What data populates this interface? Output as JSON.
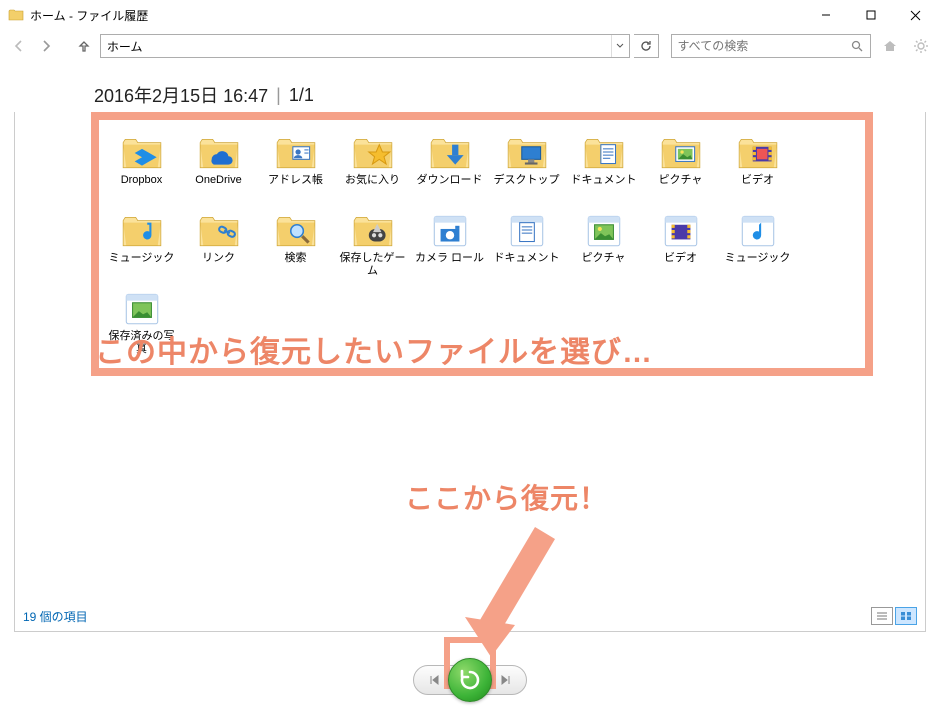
{
  "window": {
    "title": "ホーム - ファイル履歴",
    "minimize": "—",
    "maximize": "▢",
    "close": "✕"
  },
  "nav": {
    "address": "ホーム",
    "search_placeholder": "すべての検索"
  },
  "header": {
    "datetime": "2016年2月15日 16:47",
    "separator": "|",
    "page": "1/1"
  },
  "folders": [
    {
      "name": "Dropbox",
      "type": "dropbox"
    },
    {
      "name": "OneDrive",
      "type": "onedrive"
    },
    {
      "name": "アドレス帳",
      "type": "contacts"
    },
    {
      "name": "お気に入り",
      "type": "favorites"
    },
    {
      "name": "ダウンロード",
      "type": "downloads"
    },
    {
      "name": "デスクトップ",
      "type": "desktop"
    },
    {
      "name": "ドキュメント",
      "type": "documents"
    },
    {
      "name": "ピクチャ",
      "type": "pictures"
    },
    {
      "name": "ビデオ",
      "type": "videos"
    },
    {
      "name": "ミュージック",
      "type": "music"
    },
    {
      "name": "リンク",
      "type": "links"
    },
    {
      "name": "検索",
      "type": "search"
    },
    {
      "name": "保存したゲーム",
      "type": "games"
    },
    {
      "name": "カメラ ロール",
      "type": "cameraroll"
    },
    {
      "name": "ドキュメント",
      "type": "doclib"
    },
    {
      "name": "ピクチャ",
      "type": "piclib"
    },
    {
      "name": "ビデオ",
      "type": "vidlib"
    },
    {
      "name": "ミュージック",
      "type": "musiclib"
    },
    {
      "name": "保存済みの写真",
      "type": "savedpics"
    }
  ],
  "status": {
    "count": "19 個の項目"
  },
  "annotations": {
    "a1": "この中から復元したいファイルを選び…",
    "a2": "ここから復元！"
  }
}
